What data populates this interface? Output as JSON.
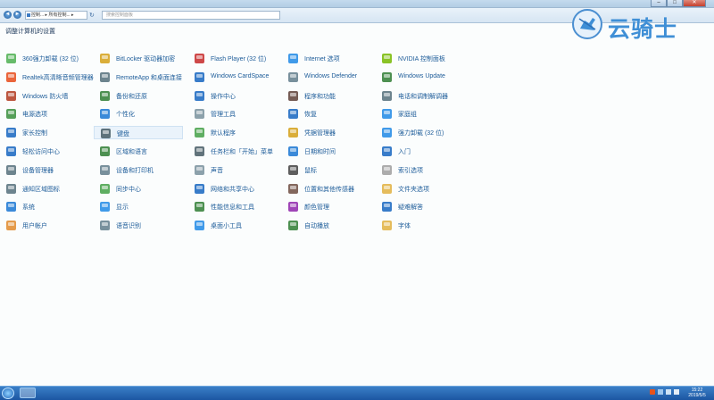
{
  "window": {
    "controls": {
      "minimize": "–",
      "maximize": "□",
      "close": "✕"
    }
  },
  "addressbar": {
    "back": "◄",
    "forward": "►",
    "breadcrumb": "控制... ▸ 所有控制... ▸",
    "refresh": "↻",
    "search_placeholder": "搜索控制面板"
  },
  "page": {
    "title": "调整计算机的设置"
  },
  "logo": {
    "text": "云骑士"
  },
  "items": [
    {
      "label": "360强力卸载 (32 位)",
      "icon": "uninstall-icon",
      "color": "#4caf50"
    },
    {
      "label": "BitLocker 驱动器加密",
      "icon": "bitlocker-key-icon",
      "color": "#d4a017"
    },
    {
      "label": "Flash Player (32 位)",
      "icon": "flash-player-icon",
      "color": "#c62828"
    },
    {
      "label": "Internet 选项",
      "icon": "internet-options-icon",
      "color": "#1e88e5"
    },
    {
      "label": "NVIDIA 控制面板",
      "icon": "nvidia-icon",
      "color": "#76b900"
    },
    {
      "label": "Realtek高清晰音频管理器",
      "icon": "audio-manager-icon",
      "color": "#e64a19"
    },
    {
      "label": "RemoteApp 和桌面连接",
      "icon": "remoteapp-icon",
      "color": "#546e7a"
    },
    {
      "label": "Windows CardSpace",
      "icon": "cardspace-icon",
      "color": "#1565c0"
    },
    {
      "label": "Windows Defender",
      "icon": "defender-icon",
      "color": "#607d8b"
    },
    {
      "label": "Windows Update",
      "icon": "windows-update-icon",
      "color": "#2e7d32"
    },
    {
      "label": "Windows 防火墙",
      "icon": "firewall-icon",
      "color": "#b23a1e"
    },
    {
      "label": "备份和还原",
      "icon": "backup-icon",
      "color": "#2e7d32"
    },
    {
      "label": "操作中心",
      "icon": "action-center-flag-icon",
      "color": "#1565c0"
    },
    {
      "label": "程序和功能",
      "icon": "programs-icon",
      "color": "#5d4037"
    },
    {
      "label": "电话和调制解调器",
      "icon": "phone-modem-icon",
      "color": "#546e7a"
    },
    {
      "label": "电源选项",
      "icon": "power-options-icon",
      "color": "#388e3c"
    },
    {
      "label": "个性化",
      "icon": "personalization-icon",
      "color": "#1976d2"
    },
    {
      "label": "管理工具",
      "icon": "admin-tools-icon",
      "color": "#78909c"
    },
    {
      "label": "恢复",
      "icon": "recovery-icon",
      "color": "#1565c0"
    },
    {
      "label": "家庭组",
      "icon": "homegroup-icon",
      "color": "#1e88e5"
    },
    {
      "label": "家长控制",
      "icon": "parental-controls-icon",
      "color": "#1565c0"
    },
    {
      "label": "键盘",
      "icon": "keyboard-icon",
      "color": "#455a64",
      "selected": true
    },
    {
      "label": "默认程序",
      "icon": "default-programs-icon",
      "color": "#43a047"
    },
    {
      "label": "凭据管理器",
      "icon": "credential-manager-icon",
      "color": "#d4a017"
    },
    {
      "label": "强力卸载 (32 位)",
      "icon": "force-uninstall-icon",
      "color": "#1e88e5"
    },
    {
      "label": "轻松访问中心",
      "icon": "ease-of-access-icon",
      "color": "#1565c0"
    },
    {
      "label": "区域和语言",
      "icon": "region-language-icon",
      "color": "#2e7d32"
    },
    {
      "label": "任务栏和「开始」菜单",
      "icon": "taskbar-start-menu-icon",
      "color": "#455a64"
    },
    {
      "label": "日期和时间",
      "icon": "date-time-icon",
      "color": "#1976d2"
    },
    {
      "label": "入门",
      "icon": "getting-started-icon",
      "color": "#1565c0"
    },
    {
      "label": "设备管理器",
      "icon": "device-manager-icon",
      "color": "#546e7a"
    },
    {
      "label": "设备和打印机",
      "icon": "devices-printers-icon",
      "color": "#607d8b"
    },
    {
      "label": "声音",
      "icon": "sound-icon",
      "color": "#78909c"
    },
    {
      "label": "鼠标",
      "icon": "mouse-icon",
      "color": "#424242"
    },
    {
      "label": "索引选项",
      "icon": "indexing-options-icon",
      "color": "#9e9e9e"
    },
    {
      "label": "通知区域图标",
      "icon": "notification-icons-icon",
      "color": "#546e7a"
    },
    {
      "label": "同步中心",
      "icon": "sync-center-icon",
      "color": "#43a047"
    },
    {
      "label": "网络和共享中心",
      "icon": "network-sharing-icon",
      "color": "#1565c0"
    },
    {
      "label": "位置和其他传感器",
      "icon": "location-sensors-icon",
      "color": "#6d4c41"
    },
    {
      "label": "文件夹选项",
      "icon": "folder-options-icon",
      "color": "#e0b040"
    },
    {
      "label": "系统",
      "icon": "system-icon",
      "color": "#1976d2"
    },
    {
      "label": "显示",
      "icon": "display-icon",
      "color": "#1e88e5"
    },
    {
      "label": "性能信息和工具",
      "icon": "performance-icon",
      "color": "#2e7d32"
    },
    {
      "label": "颜色管理",
      "icon": "color-management-icon",
      "color": "#8e24aa"
    },
    {
      "label": "疑难解答",
      "icon": "troubleshooting-icon",
      "color": "#1565c0"
    },
    {
      "label": "用户帐户",
      "icon": "user-accounts-icon",
      "color": "#e08a2c"
    },
    {
      "label": "语音识别",
      "icon": "speech-recognition-icon",
      "color": "#607d8b"
    },
    {
      "label": "桌面小工具",
      "icon": "desktop-gadgets-icon",
      "color": "#1e88e5"
    },
    {
      "label": "自动播放",
      "icon": "autoplay-icon",
      "color": "#2e7d32"
    },
    {
      "label": "字体",
      "icon": "fonts-icon",
      "color": "#e0b040"
    }
  ],
  "taskbar": {
    "clock_time": "15:22",
    "clock_date": "2019/5/5"
  },
  "colors": {
    "accent": "#1d5c99",
    "taskbar": "#1c56a2"
  }
}
